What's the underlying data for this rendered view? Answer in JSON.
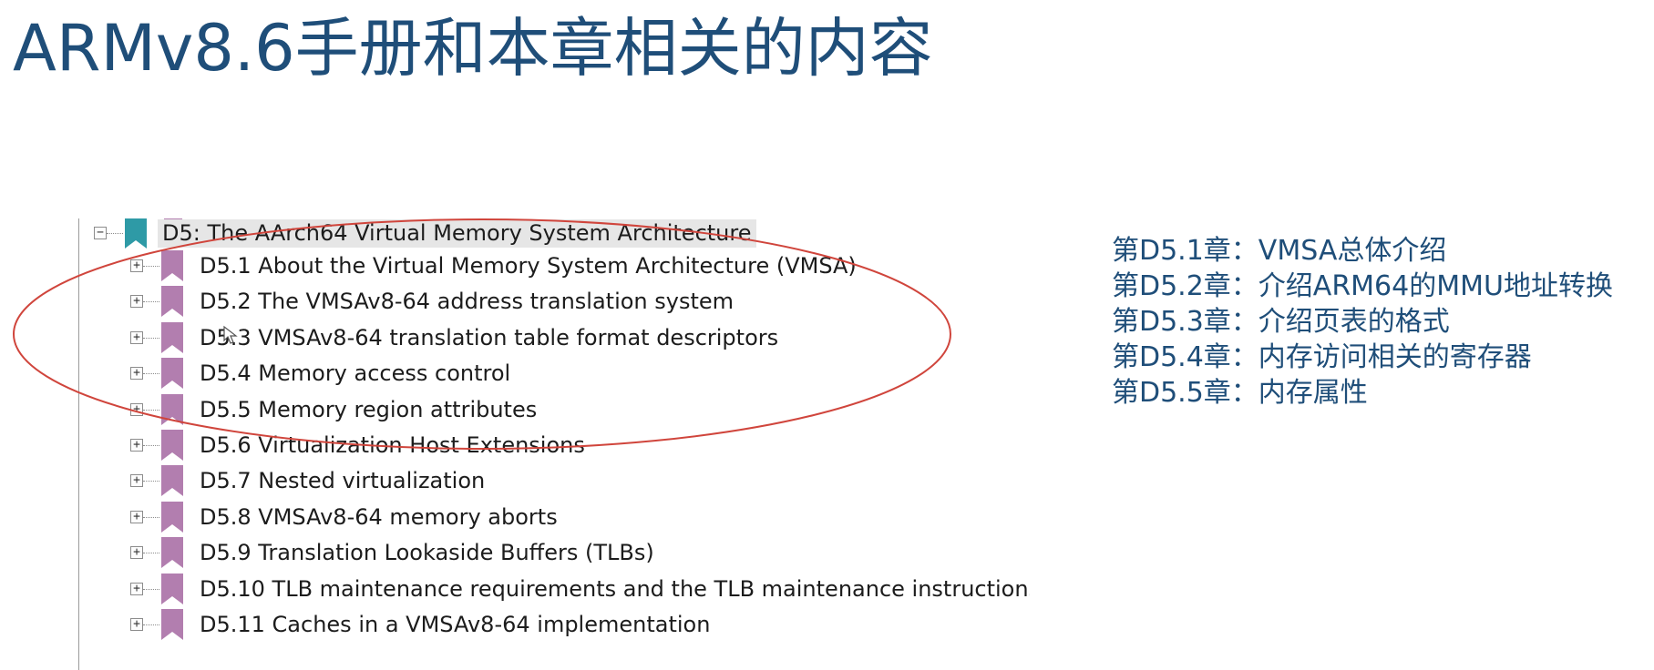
{
  "slide": {
    "title": "ARMv8.6手册和本章相关的内容"
  },
  "tree": {
    "parent": {
      "label": "D5: The AArch64 Virtual Memory System Architecture",
      "toggle": "−",
      "icon": "bookmark-icon",
      "icon_color": "#2e9aa6"
    },
    "child_icon": "bookmark-icon",
    "child_icon_color": "#b27eaf",
    "children": [
      {
        "label": "D5.1 About the Virtual Memory System Architecture (VMSA)",
        "toggle": "+"
      },
      {
        "label": "D5.2 The VMSAv8-64 address translation system",
        "toggle": "+"
      },
      {
        "label": "D5.3 VMSAv8-64 translation table format descriptors",
        "toggle": "+"
      },
      {
        "label": "D5.4 Memory access control",
        "toggle": "+"
      },
      {
        "label": "D5.5 Memory region attributes",
        "toggle": "+"
      },
      {
        "label": "D5.6 Virtualization Host Extensions",
        "toggle": "+"
      },
      {
        "label": "D5.7 Nested virtualization",
        "toggle": "+"
      },
      {
        "label": "D5.8 VMSAv8-64 memory aborts",
        "toggle": "+"
      },
      {
        "label": "D5.9 Translation Lookaside Buffers (TLBs)",
        "toggle": "+"
      },
      {
        "label": "D5.10 TLB maintenance requirements and the TLB maintenance instructions",
        "toggle": "+"
      },
      {
        "label": "D5.11 Caches in a VMSAv8-64 implementation",
        "toggle": "+"
      }
    ]
  },
  "annotation": {
    "highlight_color": "#d0453c"
  },
  "notes": [
    "第D5.1章：VMSA总体介绍",
    "第D5.2章：介绍ARM64的MMU地址转换",
    "第D5.3章：介绍页表的格式",
    "第D5.4章：内存访问相关的寄存器",
    "第D5.5章：内存属性"
  ],
  "colors": {
    "title": "#1f4e79",
    "notes": "#1f4e79",
    "selected_background": "#e6e6e6"
  }
}
